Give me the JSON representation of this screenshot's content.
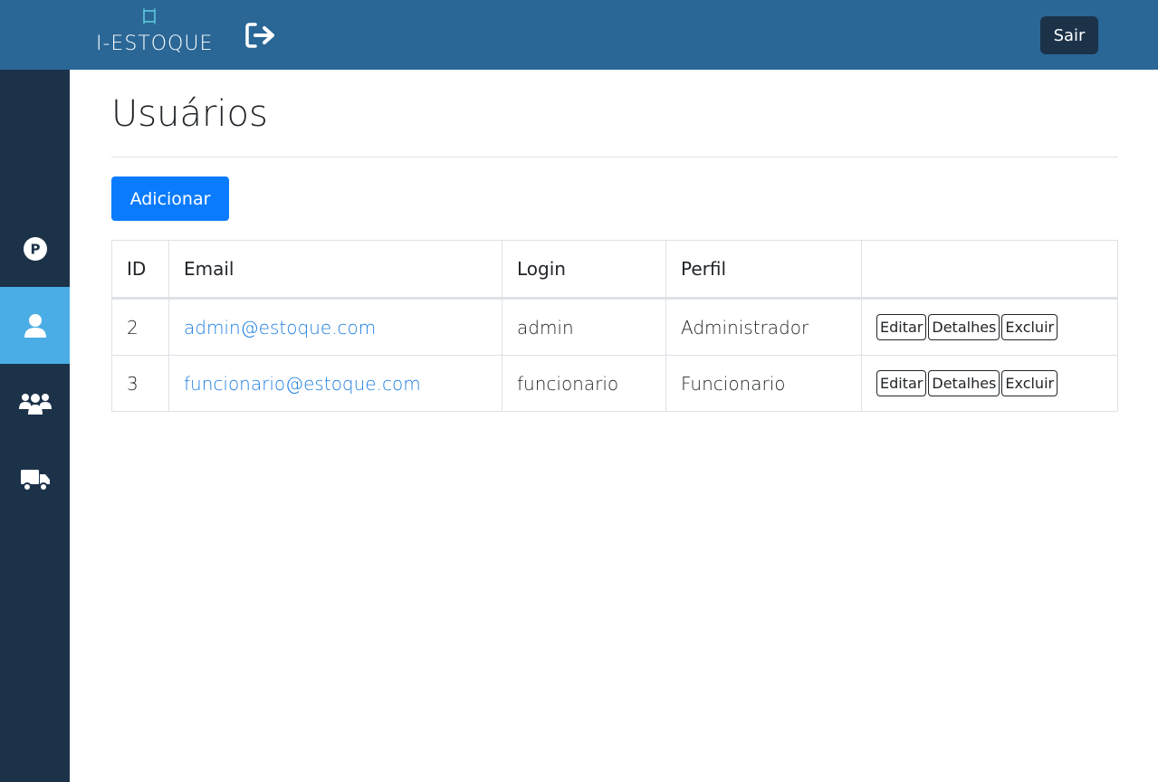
{
  "header": {
    "logo_text": "I-ESTOQUE",
    "logout_icon": "sign-out-icon",
    "sair_label": "Sair",
    "brand_color": "#2a6796",
    "sair_bg_color": "#1b3249"
  },
  "sidebar": {
    "bg_color": "#1b3249",
    "active_color": "#4aade5",
    "items": [
      {
        "icon": "product-p-icon",
        "active": false
      },
      {
        "icon": "user-icon",
        "active": true
      },
      {
        "icon": "users-group-icon",
        "active": false
      },
      {
        "icon": "truck-icon",
        "active": false
      }
    ]
  },
  "main": {
    "title": "Usuários",
    "add_label": "Adicionar",
    "table": {
      "headers": [
        "ID",
        "Email",
        "Login",
        "Perfil",
        ""
      ],
      "rows": [
        {
          "id": "2",
          "email": "admin@estoque.com",
          "login": "admin",
          "perfil": "Administrador"
        },
        {
          "id": "3",
          "email": "funcionario@estoque.com",
          "login": "funcionario",
          "perfil": "Funcionario"
        }
      ],
      "actions": {
        "edit": "Editar",
        "details": "Detalhes",
        "delete": "Excluir"
      }
    }
  }
}
